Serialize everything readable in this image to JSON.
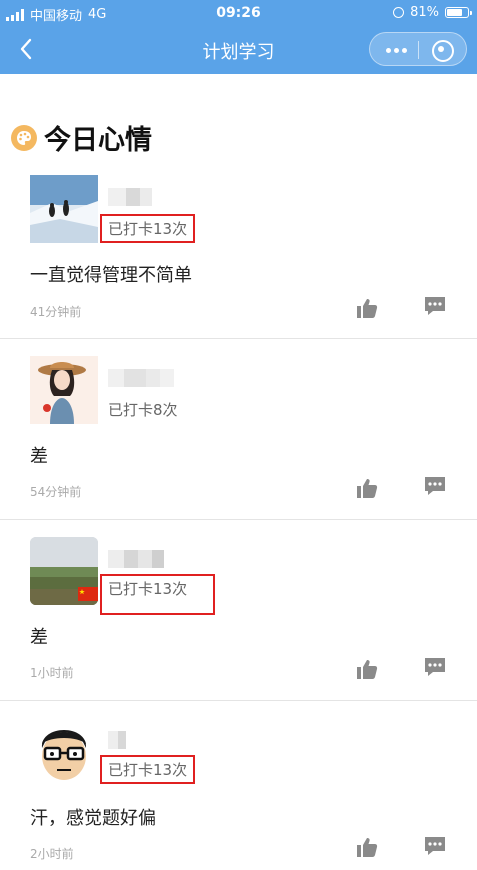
{
  "status_bar": {
    "carrier": "中国移动",
    "network": "4G",
    "time": "09:26",
    "battery_percent": "81%",
    "battery_level": 0.81
  },
  "nav": {
    "title": "计划学习"
  },
  "section": {
    "title": "今日心情",
    "icon": "palette-icon",
    "icon_color": "#f4b860"
  },
  "colors": {
    "nav_bg": "#5aa3e8",
    "highlight_border": "#e02020"
  },
  "posts": [
    {
      "checkin": "已打卡13次",
      "content": "一直觉得管理不简单",
      "time": "41分钟前",
      "highlighted": true
    },
    {
      "checkin": "已打卡8次",
      "content": "差",
      "time": "54分钟前",
      "highlighted": false
    },
    {
      "checkin": "已打卡13次",
      "content": "差",
      "time": "1小时前",
      "highlighted": true
    },
    {
      "checkin": "已打卡13次",
      "content": "汗，感觉题好偏",
      "time": "2小时前",
      "highlighted": true
    }
  ]
}
